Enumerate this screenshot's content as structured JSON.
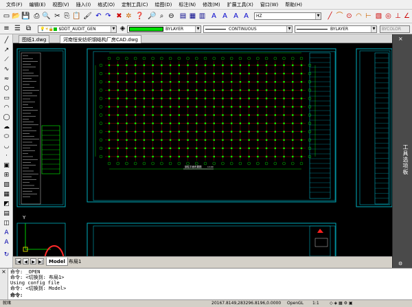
{
  "menu": [
    "文件(F)",
    "编辑(E)",
    "视图(V)",
    "插入(I)",
    "格式(O)",
    "定制工具(C)",
    "绘图(D)",
    "标注(N)",
    "修改(M)",
    "扩展工具(X)",
    "窗口(W)",
    "帮助(H)"
  ],
  "toolbar": {
    "text_style": "HZ",
    "layer": "$DDT_AUDIT_GEN",
    "color": "BYLAYER",
    "linetype": "CONTINUOUS",
    "lineweight": "BYLAYER",
    "plotstyle": "BYCOLOR"
  },
  "file_tabs": [
    "图纸1.dwg",
    "河南恒安纺织钢结构厂房CAD.dwg"
  ],
  "drawing": {
    "plan_title": "钢柱平面布置图",
    "plan_scale": "1:100"
  },
  "right_panel": {
    "label": "工具选项板"
  },
  "layout_tabs": [
    "Model",
    "布局1"
  ],
  "command_lines": [
    "命令: _OPEN",
    "命令: <切换到: 布局1>",
    "Using config file",
    "命令: <切换到: Model>"
  ],
  "command_prompt": "命令:",
  "status": {
    "left": "就绪",
    "coords": "20167.8149,283296.8196,0.0000",
    "opengl": "OpenGL",
    "scale": "1:1"
  },
  "colors": {
    "canvas": "#000000",
    "grid_axes": "#cc0000",
    "columns": "#00ff00",
    "frame": "#00b0c0",
    "annotation": "#ff2a2a"
  }
}
